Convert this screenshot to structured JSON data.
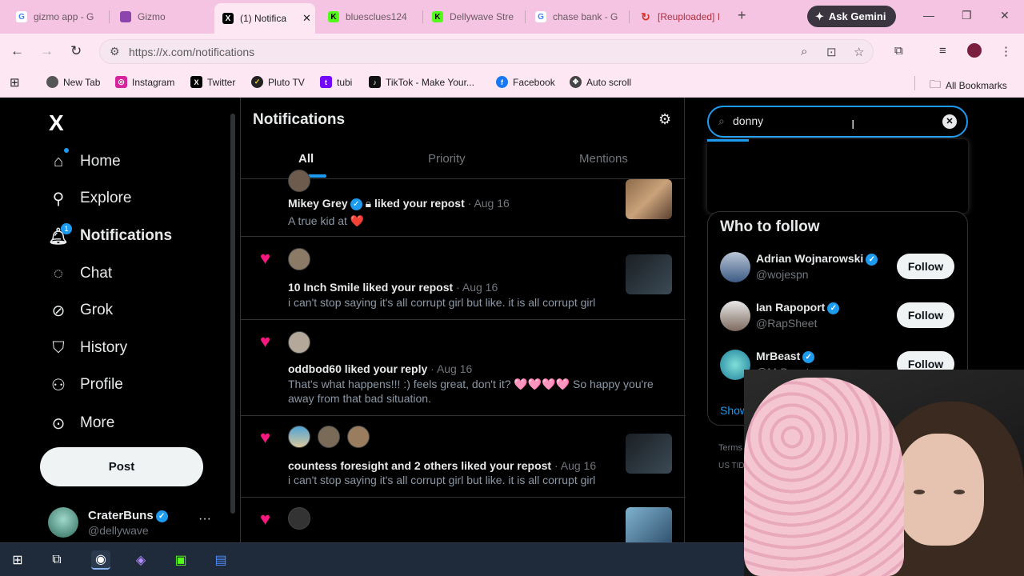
{
  "browser": {
    "tabs": [
      {
        "title": "gizmo app - G",
        "icon": "google-icon",
        "color": "#4285f4"
      },
      {
        "title": "Gizmo",
        "icon": "gizmo-icon",
        "color": "#8e44ad"
      },
      {
        "title": "(1) Notifica",
        "icon": "x-icon",
        "color": "#000000",
        "active": true
      },
      {
        "title": "bluesclues124",
        "icon": "kick-icon",
        "color": "#53fc18"
      },
      {
        "title": "Dellywave Stre",
        "icon": "kick-icon",
        "color": "#53fc18"
      },
      {
        "title": "chase bank - G",
        "icon": "google-icon",
        "color": "#4285f4"
      },
      {
        "title": "[Reuploaded] I",
        "icon": "refresh-icon",
        "color": "#d93025"
      }
    ],
    "gemini_label": "Ask Gemini",
    "url": "https://x.com/notifications",
    "bookmarks": [
      {
        "label": "New Tab",
        "icon": "chrome-icon"
      },
      {
        "label": "Instagram",
        "icon": "instagram-icon"
      },
      {
        "label": "Twitter",
        "icon": "x-icon"
      },
      {
        "label": "Pluto TV",
        "icon": "pluto-icon"
      },
      {
        "label": "tubi",
        "icon": "tubi-icon"
      },
      {
        "label": "TikTok - Make Your...",
        "icon": "tiktok-icon"
      },
      {
        "label": "Facebook",
        "icon": "facebook-icon"
      },
      {
        "label": "Auto scroll",
        "icon": "scroll-icon"
      }
    ],
    "all_bookmarks": "All Bookmarks"
  },
  "sidebar": {
    "logo": "X",
    "items": [
      {
        "label": "Home",
        "icon": "home-icon"
      },
      {
        "label": "Explore",
        "icon": "search-icon"
      },
      {
        "label": "Notifications",
        "icon": "bell-icon",
        "badge": "1"
      },
      {
        "label": "Chat",
        "icon": "chat-icon"
      },
      {
        "label": "Grok",
        "icon": "grok-icon"
      },
      {
        "label": "History",
        "icon": "bookmark-icon"
      },
      {
        "label": "Profile",
        "icon": "person-icon"
      },
      {
        "label": "More",
        "icon": "more-icon"
      }
    ],
    "post_label": "Post",
    "user": {
      "name": "CraterBuns",
      "handle": "@dellywave"
    }
  },
  "notifications": {
    "title": "Notifications",
    "tabs": [
      "All",
      "Priority",
      "Mentions"
    ],
    "items": [
      {
        "actor": "Mikey Grey",
        "verified": true,
        "locked": true,
        "action": "liked your repost",
        "date": "Aug 16",
        "text": "A true kid at ❤️"
      },
      {
        "actor": "10 Inch Smile",
        "action": "liked your repost",
        "date": "Aug 16",
        "text": "i can't stop saying it's all corrupt girl but like. it is all corrupt girl"
      },
      {
        "actor": "oddbod60",
        "action": "liked your reply",
        "date": "Aug 16",
        "text_line1": "That's what happens!!! :) feels great, don't it? 🩷🩷🩷🩷 So happy you're",
        "text_line2": "away from that bad situation."
      },
      {
        "actor": "countess foresight",
        "action": "and 2 others liked your repost",
        "date": "Aug 16",
        "text": "i can't stop saying it's all corrupt girl but like. it is all corrupt girl"
      }
    ]
  },
  "search": {
    "value": "donny"
  },
  "who_to_follow": {
    "title": "Who to follow",
    "accounts": [
      {
        "name": "Adrian Wojnarowski",
        "handle": "@wojespn",
        "follow": "Follow"
      },
      {
        "name": "Ian Rapoport",
        "handle": "@RapSheet",
        "follow": "Follow"
      },
      {
        "name": "MrBeast",
        "handle": "@MrBeast",
        "follow": "Follow"
      }
    ],
    "show_more": "Show more"
  },
  "footer": {
    "terms": "Terms",
    "region": "US TIDA"
  }
}
